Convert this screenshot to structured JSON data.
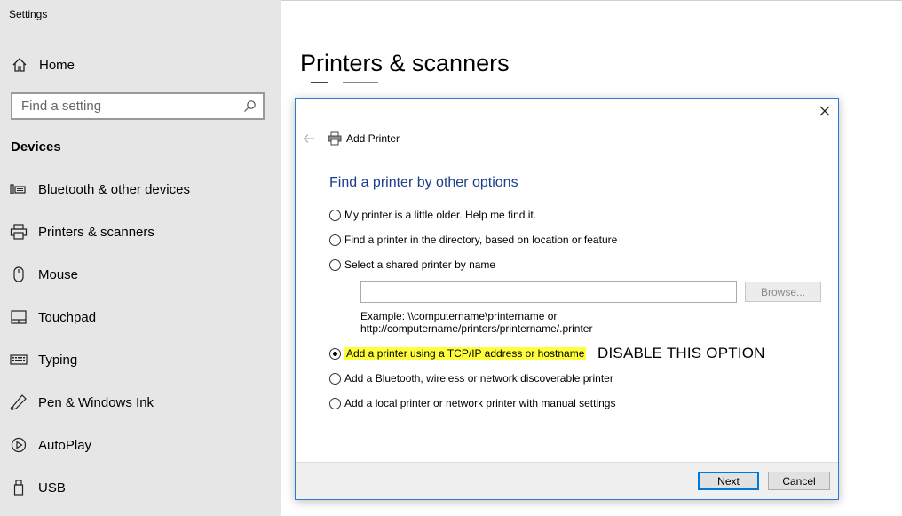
{
  "app": {
    "title": "Settings"
  },
  "sidebar": {
    "home_label": "Home",
    "search_placeholder": "Find a setting",
    "section_title": "Devices",
    "items": [
      {
        "label": "Bluetooth & other devices",
        "icon": "bluetooth-devices-icon"
      },
      {
        "label": "Printers & scanners",
        "icon": "printer-icon"
      },
      {
        "label": "Mouse",
        "icon": "mouse-icon"
      },
      {
        "label": "Touchpad",
        "icon": "touchpad-icon"
      },
      {
        "label": "Typing",
        "icon": "keyboard-icon"
      },
      {
        "label": "Pen & Windows Ink",
        "icon": "pen-icon"
      },
      {
        "label": "AutoPlay",
        "icon": "autoplay-icon"
      },
      {
        "label": "USB",
        "icon": "usb-icon"
      }
    ]
  },
  "main": {
    "title": "Printers & scanners"
  },
  "dialog": {
    "title": "Add Printer",
    "heading": "Find a printer by other options",
    "options": [
      {
        "label": "My printer is a little older. Help me find it.",
        "selected": false
      },
      {
        "label": "Find a printer in the directory, based on location or feature",
        "selected": false
      },
      {
        "label": "Select a shared printer by name",
        "selected": false
      },
      {
        "label": "Add a printer using a TCP/IP address or hostname",
        "selected": true
      },
      {
        "label": "Add a Bluetooth, wireless or network discoverable printer",
        "selected": false
      },
      {
        "label": "Add a local printer or network printer with manual settings",
        "selected": false
      }
    ],
    "shared_name_value": "",
    "browse_label": "Browse...",
    "example_line1": "Example: \\\\computername\\printername or",
    "example_line2": "http://computername/printers/printername/.printer",
    "annotation": "DISABLE THIS OPTION",
    "highlight_color": "#ffff3c",
    "next_label": "Next",
    "cancel_label": "Cancel"
  }
}
